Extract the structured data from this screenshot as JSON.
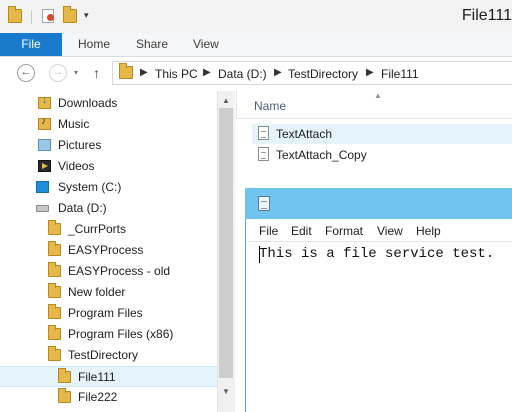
{
  "window": {
    "title": "File111"
  },
  "quick_access": {
    "icons": [
      "folder-icon",
      "properties-icon",
      "new-folder-icon"
    ],
    "dropdown_glyph": "▾"
  },
  "ribbon": {
    "tabs": [
      "File",
      "Home",
      "Share",
      "View"
    ]
  },
  "navigation": {
    "back_glyph": "←",
    "forward_glyph": "→",
    "recent_glyph": "▾",
    "up_glyph": "↑",
    "breadcrumb": [
      "This PC",
      "Data (D:)",
      "TestDirectory",
      "File111"
    ],
    "crumb_separator": "▶"
  },
  "tree": {
    "items": [
      {
        "label": "Downloads",
        "icon": "downloads-icon"
      },
      {
        "label": "Music",
        "icon": "music-icon"
      },
      {
        "label": "Pictures",
        "icon": "pictures-icon"
      },
      {
        "label": "Videos",
        "icon": "videos-icon"
      },
      {
        "label": "System (C:)",
        "icon": "windows-drive-icon"
      },
      {
        "label": "Data (D:)",
        "icon": "drive-icon"
      },
      {
        "label": "_CurrPorts",
        "icon": "folder-icon"
      },
      {
        "label": "EASYProcess",
        "icon": "folder-icon"
      },
      {
        "label": "EASYProcess - old",
        "icon": "folder-icon"
      },
      {
        "label": "New folder",
        "icon": "folder-icon"
      },
      {
        "label": "Program Files",
        "icon": "folder-icon"
      },
      {
        "label": "Program Files (x86)",
        "icon": "folder-icon"
      },
      {
        "label": "TestDirectory",
        "icon": "folder-icon"
      },
      {
        "label": "File111",
        "icon": "folder-icon",
        "selected": true
      },
      {
        "label": "File222",
        "icon": "folder-icon"
      }
    ],
    "scroll_up_glyph": "▲",
    "scroll_down_glyph": "▼"
  },
  "file_list": {
    "column_name": "Name",
    "sort_glyph": "▲",
    "files": [
      {
        "label": "TextAttach",
        "icon": "text-file-icon"
      },
      {
        "label": "TextAttach_Copy",
        "icon": "text-file-icon"
      }
    ]
  },
  "notepad": {
    "menu": [
      "File",
      "Edit",
      "Format",
      "View",
      "Help"
    ],
    "content": "This is a file service test."
  },
  "colors": {
    "file_tab": "#1979ca",
    "notepad_titlebar": "#6fc3ec",
    "selection": "#e5f3fb",
    "folder": "#e6b84a"
  }
}
